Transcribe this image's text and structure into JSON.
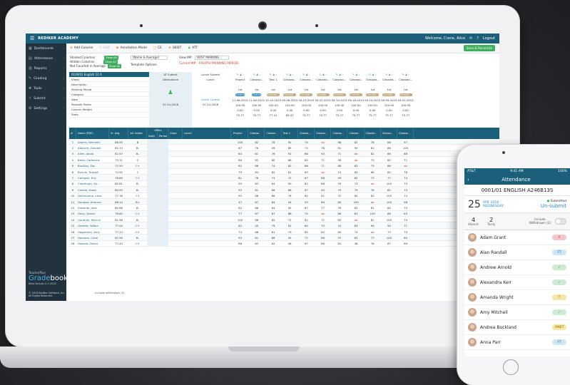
{
  "app": {
    "brand": "REDIKER ACADEMY",
    "welcome": "Welcome, Crane, Alice",
    "logout": "Logout"
  },
  "sidebar": {
    "items": [
      {
        "label": "Dashboards",
        "icon": "dashboard-icon"
      },
      {
        "label": "Attendance",
        "icon": "calendar-icon"
      },
      {
        "label": "Reports",
        "icon": "report-icon"
      },
      {
        "label": "Grading",
        "icon": "grading-icon"
      },
      {
        "label": "Tools",
        "icon": "wrench-icon"
      },
      {
        "label": "Submit",
        "icon": "submit-icon"
      },
      {
        "label": "Settings",
        "icon": "gear-icon"
      }
    ],
    "logo_top": "TeacherPlus",
    "logo_grade": "Grade",
    "logo_book": "book",
    "version": "Beta Version 0.1.2025",
    "copyright": "© 2018 Rediker Software, Inc.",
    "rights": "All Rights Reserved."
  },
  "toolbar": {
    "add_column": "Add Column",
    "edit": "Edit",
    "annotation_mode": "Annotation Mode",
    "ce": "CE",
    "skist": "SKIST",
    "att": "ATT",
    "save_reconcile": "Save & Reconcile"
  },
  "options": {
    "shaded_columns": "Shaded Columns",
    "hidden_columns": "Hidden Columns",
    "not_counted": "Not Counted in Average",
    "pill_shaded": "Show All",
    "pill_hidden": "Show All",
    "pill_not_counted": "Show All",
    "name_select": "[Name & Average]",
    "template_options": "Template Options",
    "view_mp_label": "View MP:",
    "view_mp_value": "FIRST MARKING...",
    "current_mp": "Current MP:",
    "current_mp_value": "FOURTH MARKING PERIOD"
  },
  "gradebook": {
    "course_title": "0100/01 English 12 A",
    "row_labels": [
      "Views",
      "Description",
      "Marking Period",
      "Category",
      "Date",
      "Possible Points",
      "Column Weight",
      "Stats"
    ],
    "at_submit": "AT Submit",
    "attendance": "Attendance",
    "att_date": "07-24-2018",
    "lunch_submit": "Lunch Submit",
    "lunch": "Lunch",
    "lunch_counts": "Lunch Counts",
    "lunch_date": "07-24-2018",
    "assignments": [
      {
        "name": "Project",
        "mp": "1st",
        "cat": "Exams",
        "date": "11-08-2015",
        "pts": "100.00",
        "wt": "0.00",
        "stat": "75.77"
      },
      {
        "name": "Classwo...",
        "mp": "1st",
        "cat": "Exams",
        "date": "11-08-2015",
        "pts": "100.00",
        "wt": "0.00",
        "stat": "75.77"
      },
      {
        "name": "Test 1",
        "mp": "1st",
        "cat": "Formati...",
        "date": "10-15-2015",
        "pts": "100.00",
        "wt": "0.00",
        "stat": "77.12"
      },
      {
        "name": "Classwo...",
        "mp": "1st",
        "cat": "Formati...",
        "date": "09-08-2015",
        "pts": "100.00",
        "wt": "0.00",
        "stat": "65.47"
      },
      {
        "name": "Classwo...",
        "mp": "1st",
        "cat": "Formati...",
        "date": "09-23-2015",
        "pts": "100.00",
        "wt": "0.00",
        "stat": "75.77"
      },
      {
        "name": "Classwo...",
        "mp": "1st",
        "cat": "Formati...",
        "date": "09-22-2015",
        "pts": "100.00",
        "wt": "0.00",
        "stat": "75.77"
      },
      {
        "name": "Classwo...",
        "mp": "1st",
        "cat": "Formati...",
        "date": "09-19-2015",
        "pts": "100.00",
        "wt": "0.00",
        "stat": "75.77"
      },
      {
        "name": "Classwo...",
        "mp": "1st",
        "cat": "Formati...",
        "date": "09-16-2015",
        "pts": "100.00",
        "wt": "0.00",
        "stat": "75.77"
      },
      {
        "name": "Classwo...",
        "mp": "1st",
        "cat": "Formati...",
        "date": "09-14-2015",
        "pts": "100.00",
        "wt": "0.00",
        "stat": "75.77"
      },
      {
        "name": "Classwo...",
        "mp": "1st",
        "cat": "Formati...",
        "date": "09-09-2015",
        "pts": "100.00",
        "wt": "0.00",
        "stat": "75.77"
      },
      {
        "name": "Classwo...",
        "mp": "1st",
        "cat": "Formati...",
        "date": "09-01-2015",
        "pts": "100.00",
        "wt": "0.00",
        "stat": "75.77"
      }
    ],
    "headers": [
      "#",
      "Name (PDF)",
      "Yr. Avg.",
      "1st Grade",
      "Daily",
      "Period",
      "Class",
      "Lunch",
      "Project",
      "Classw...",
      "Classw...",
      "Test 1",
      "Classw...",
      "Classw...",
      "Classw...",
      "Classw...",
      "Classw...",
      "Classw...",
      "Classw..."
    ],
    "office_header": "Office",
    "students": [
      {
        "n": "1",
        "name": "Adams, Kenneth",
        "avg": "86.55",
        "g": "B",
        "s": [
          "100",
          "82",
          "76",
          "92",
          "74",
          "ab",
          "68",
          "82",
          "76",
          "86",
          "97"
        ]
      },
      {
        "n": "2",
        "name": "Albrecht, Kendall",
        "avg": "81.74",
        "g": "B-",
        "s": [
          "87",
          "76",
          "59",
          "85",
          "74",
          "76",
          "81",
          "93",
          "81",
          "86",
          "100"
        ]
      },
      {
        "n": "3",
        "name": "Allen, Jacob",
        "avg": "82.57",
        "g": "B-",
        "s": [
          "84",
          "81",
          "76",
          "91",
          "68",
          "93",
          "71",
          "ab",
          "82",
          "86",
          "88"
        ]
      },
      {
        "n": "4",
        "name": "Baird, Catherine",
        "avg": "73.11",
        "g": "C",
        "s": [
          "86",
          "62",
          "60",
          "66",
          "60",
          "71",
          "56",
          "ab",
          "73",
          "80",
          "71"
        ]
      },
      {
        "n": "5",
        "name": "Buckley, Zac",
        "avg": "77.50",
        "g": "C+",
        "s": [
          "82",
          "66",
          "74",
          "82",
          "66",
          "71",
          "68",
          "82",
          "73",
          "86",
          "ab"
        ]
      },
      {
        "n": "6",
        "name": "Bynum, Russell",
        "avg": "74.55",
        "g": "C",
        "s": [
          "79",
          "64",
          "82",
          "81",
          "63",
          "ab",
          "74",
          "82",
          "66",
          "80",
          "78"
        ]
      },
      {
        "n": "7",
        "name": "Carrigan, Eric",
        "avg": "78.85",
        "g": "C+",
        "s": [
          "81",
          "78",
          "74",
          "72",
          "67",
          "68",
          "49",
          "82",
          "73",
          "77",
          "74"
        ]
      },
      {
        "n": "8",
        "name": "Clairthugh, Ge...",
        "avg": "80.81",
        "g": "B-",
        "s": [
          "95",
          "83",
          "64",
          "90",
          "82",
          "66",
          "76",
          "74",
          "ab",
          "100",
          "75"
        ]
      },
      {
        "n": "9",
        "name": "Conlee, Dawn",
        "avg": "80.93",
        "g": "B-",
        "s": [
          "93",
          "81",
          "66",
          "86",
          "67",
          "63",
          "79",
          "79",
          "76",
          "82",
          "75"
        ]
      },
      {
        "n": "10",
        "name": "DeGiacomo, Lena",
        "avg": "77.18",
        "g": "C+",
        "s": [
          "95",
          "68",
          "66",
          "76",
          "62",
          "61",
          "72",
          "82",
          "82",
          "100",
          "74"
        ]
      },
      {
        "n": "11",
        "name": "Douglas, Arianna",
        "avg": "88.14",
        "g": "B+",
        "s": [
          "47",
          "87",
          "84",
          "94",
          "93",
          "89",
          "80",
          "100",
          "ab",
          "100",
          "98"
        ]
      },
      {
        "n": "12",
        "name": "Edwards, Jane",
        "avg": "80.66",
        "g": "B-",
        "s": [
          "82",
          "88",
          "64",
          "92",
          "87",
          "77",
          "76",
          "82",
          "81",
          "84",
          "75"
        ]
      },
      {
        "n": "13",
        "name": "Foley, Daniel",
        "avg": "76.82",
        "g": "C+",
        "s": [
          "77",
          "67",
          "67",
          "88",
          "75",
          "ab",
          "86",
          "81",
          "100",
          "86",
          "63"
        ]
      },
      {
        "n": "14",
        "name": "Gauthier, Patrick",
        "avg": "81.56",
        "g": "B-",
        "s": [
          "100",
          "66",
          "82",
          "72",
          "62",
          "71",
          "82",
          "ab",
          "81",
          "100",
          "79"
        ]
      },
      {
        "n": "15",
        "name": "Gerelds, Wilbur",
        "avg": "77.04",
        "g": "C+",
        "s": [
          "82",
          "45",
          "79",
          "81",
          "60",
          "70",
          "74",
          "83",
          "94",
          "94",
          "71"
        ]
      },
      {
        "n": "16",
        "name": "Hagerman, Amy",
        "avg": "77.22",
        "g": "C+",
        "s": [
          "74",
          "66",
          "81",
          "79",
          "85",
          "62",
          "60",
          "74",
          "ab",
          "73",
          "79"
        ]
      },
      {
        "n": "17",
        "name": "Harrison, Carol",
        "avg": "82.59",
        "g": "B-",
        "s": [
          "93",
          "81",
          "66",
          "92",
          "72",
          "66",
          "70",
          "82",
          "73",
          "100",
          "80"
        ]
      },
      {
        "n": "18",
        "name": "Howard, David",
        "avg": "77.43",
        "g": "C+",
        "s": [
          "88",
          "63",
          "82",
          "46",
          "97",
          "86",
          "62",
          "48",
          "76",
          "87",
          "69"
        ]
      }
    ],
    "footer": "Include withdrawn (2)"
  },
  "phone": {
    "carrier": "AT&T",
    "time": "9:41 AM",
    "battery": "100%",
    "title": "Attendance",
    "course": "0001/01 ENGLISH A246B13S",
    "day": "25",
    "month_year": "APR 2018",
    "weekday": "WEDNESDAY",
    "submitted": "Submitted",
    "unsubmit": "Un-submit",
    "absent_count": "4",
    "absent_label": "Absent",
    "tardy_count": "2",
    "tardy_label": "Tardy",
    "include_withdrawn": "Include Withdrawn (2)",
    "students": [
      {
        "name": "Adam Grant",
        "status": "A",
        "bg": "#f6c6c6",
        "fg": "#c13a3a"
      },
      {
        "name": "Alan Randall",
        "status": "FT",
        "bg": "#cde6f5",
        "fg": "#2b6e99"
      },
      {
        "name": "Andrew Arnold",
        "status": "✓",
        "bg": "#cfead3",
        "fg": "#2f8c45"
      },
      {
        "name": "Alexandra Kerr",
        "status": "✓",
        "bg": "#cfead3",
        "fg": "#2f8c45"
      },
      {
        "name": "Amanda Wright",
        "status": "T",
        "bg": "#f7e7a6",
        "fg": "#8b6e0a"
      },
      {
        "name": "Amy Mitchell",
        "status": "✓",
        "bg": "#cfead3",
        "fg": "#2f8c45"
      },
      {
        "name": "Andrea Buckland",
        "status": "AMET",
        "bg": "#f7e7a6",
        "fg": "#8b6e0a"
      },
      {
        "name": "Anna Parr",
        "status": "FT",
        "bg": "#cde6f5",
        "fg": "#2b6e99"
      }
    ]
  }
}
